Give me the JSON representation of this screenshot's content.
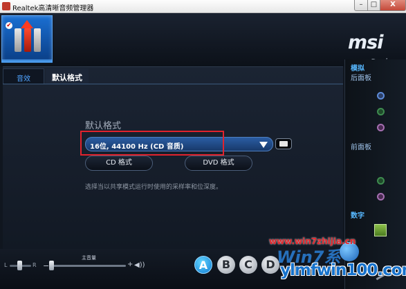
{
  "window": {
    "title": "Realtek高清晰音频管理器",
    "min_label": "–",
    "max_label": "□",
    "close_label": "X"
  },
  "header": {
    "brand": "msi",
    "info_label": "i",
    "device_check": "✔"
  },
  "tabs": [
    {
      "label": "音效"
    },
    {
      "label": "默认格式"
    }
  ],
  "default_format": {
    "section_title": "默认格式",
    "selected_format": "16位, 44100 Hz (CD 音质)",
    "cd_button": "CD 格式",
    "dvd_button": "DVD 格式",
    "help_text": "选择当以共享模式运行时使用的采样率和位深度。"
  },
  "right_panel": {
    "analog_heading": "模拟",
    "back_panel_heading": "后面板",
    "front_panel_heading": "前面板",
    "digital_heading": "数字"
  },
  "bottom_bar": {
    "balance_left": "L",
    "balance_right": "R",
    "main_volume_label": "主音量",
    "volume_minus": "−",
    "volume_plus": "+",
    "speaker_symbol": "◀))",
    "profiles": [
      "A",
      "B",
      "C",
      "D"
    ]
  },
  "watermark": {
    "url_top": "www.win7zhijia.cn",
    "brand_text": "Win7系",
    "url_bottom": "ylmfwin100.com"
  },
  "colors": {
    "accent_blue": "#4fa3ff",
    "highlight_red": "#e2232d",
    "select_blue": "#2b5da3"
  }
}
